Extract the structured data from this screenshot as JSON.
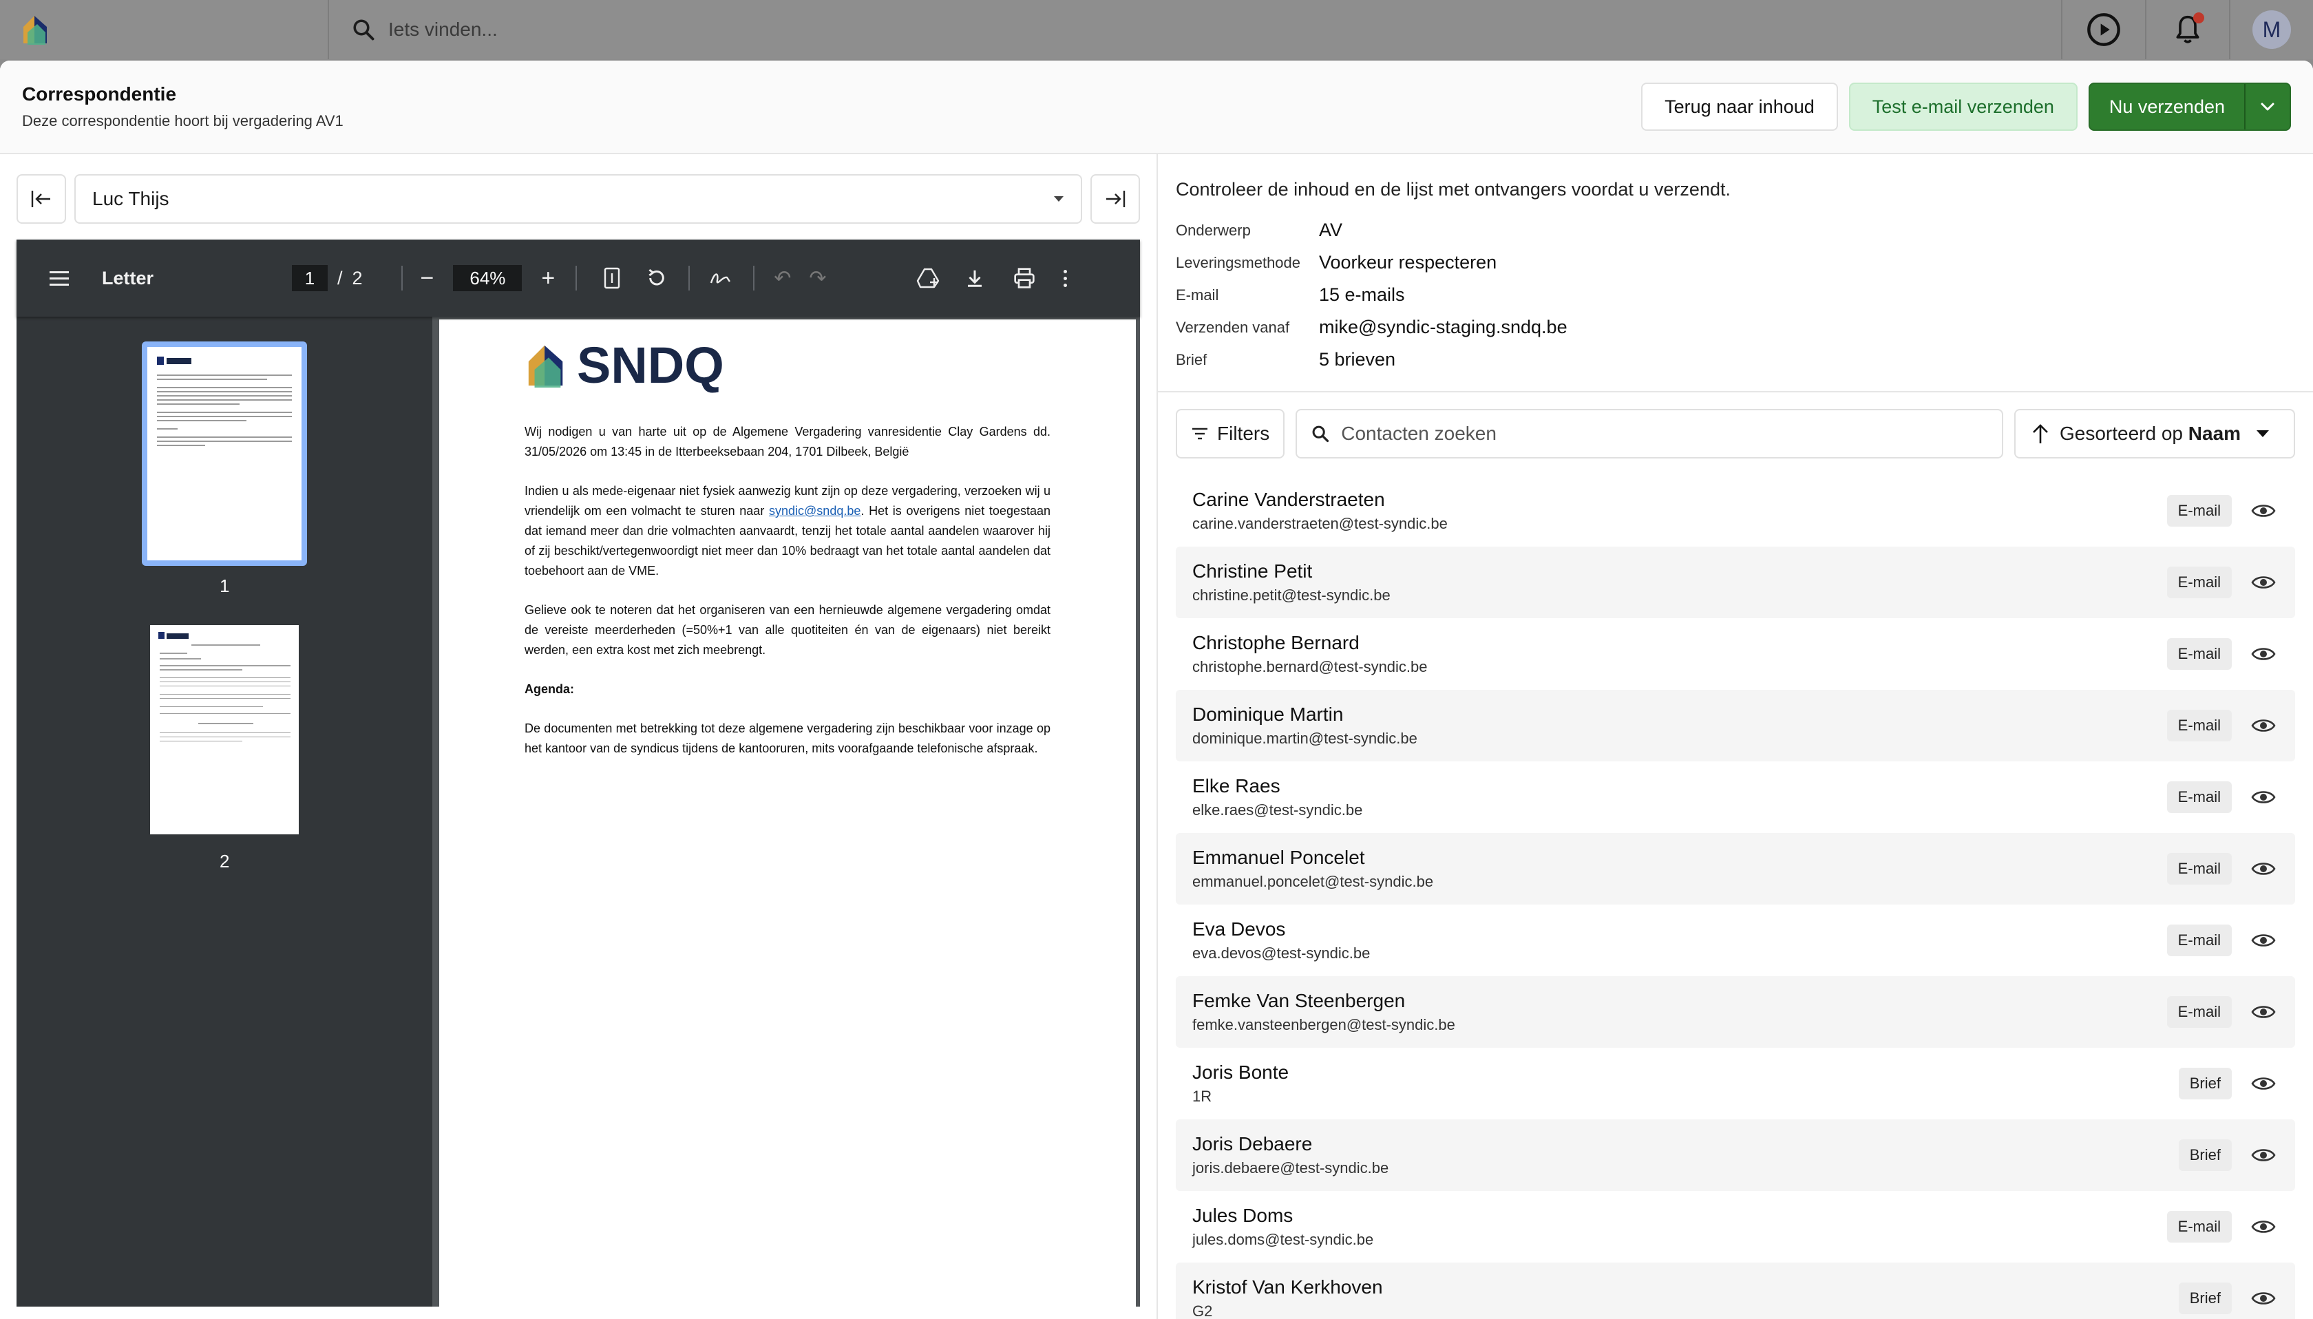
{
  "topbar": {
    "search_placeholder": "Iets vinden...",
    "avatar_initial": "M"
  },
  "header": {
    "title": "Correspondentie",
    "subtitle": "Deze correspondentie hoort bij vergadering AV1",
    "back_label": "Terug naar inhoud",
    "test_label": "Test e-mail verzenden",
    "send_label": "Nu verzenden"
  },
  "recipient_select": {
    "value": "Luc Thijs"
  },
  "pdf": {
    "title": "Letter",
    "page_current": "1",
    "page_sep": "/",
    "page_total": "2",
    "zoom": "64%",
    "thumb1_label": "1",
    "thumb2_label": "2"
  },
  "letter": {
    "brand": "SNDQ",
    "p1": "Wij nodigen u van harte uit op de Algemene Vergadering vanresidentie Clay Gardens dd. 31/05/2026 om 13:45 in de Itterbeeksebaan 204, 1701 Dilbeek, België",
    "p2_a": "Indien u als mede-eigenaar niet fysiek aanwezig kunt zijn op deze vergadering, verzoeken wij u vriendelijk om een volmacht te sturen naar ",
    "p2_link": "syndic@sndq.be",
    "p2_b": ". Het is overigens niet toegestaan dat iemand meer dan drie volmachten aanvaardt, tenzij het totale aantal aandelen waarover hij of zij beschikt/vertegenwoordigt niet meer dan 10% bedraagt van het totale aantal aandelen dat toebehoort aan de VME.",
    "p3": "Gelieve ook te noteren dat het organiseren van een hernieuwde algemene vergadering omdat de vereiste meerderheden (=50%+1 van alle quotiteiten én van de eigenaars) niet bereikt werden, een extra kost met zich meebrengt.",
    "agenda": "Agenda:",
    "p4": "De documenten met betrekking tot deze algemene vergadering zijn beschikbaar voor inzage op het kantoor van de syndicus tijdens de kantooruren, mits voorafgaande telefonische afspraak."
  },
  "summary": {
    "intro": "Controleer de inhoud en de lijst met ontvangers voordat u verzendt.",
    "rows": [
      {
        "key": "Onderwerp",
        "value": "AV"
      },
      {
        "key": "Leveringsmethode",
        "value": "Voorkeur respecteren"
      },
      {
        "key": "E-mail",
        "value": "15 e-mails"
      },
      {
        "key": "Verzenden vanaf",
        "value": "mike@syndic-staging.sndq.be"
      },
      {
        "key": "Brief",
        "value": "5 brieven"
      }
    ]
  },
  "filters": {
    "filter_label": "Filters",
    "search_placeholder": "Contacten zoeken",
    "sort_prefix": "Gesorteerd op ",
    "sort_field": "Naam"
  },
  "contacts": [
    {
      "name": "Carine Vanderstraeten",
      "detail": "carine.vanderstraeten@test-syndic.be",
      "method": "E-mail"
    },
    {
      "name": "Christine Petit",
      "detail": "christine.petit@test-syndic.be",
      "method": "E-mail"
    },
    {
      "name": "Christophe Bernard",
      "detail": "christophe.bernard@test-syndic.be",
      "method": "E-mail"
    },
    {
      "name": "Dominique Martin",
      "detail": "dominique.martin@test-syndic.be",
      "method": "E-mail"
    },
    {
      "name": "Elke Raes",
      "detail": "elke.raes@test-syndic.be",
      "method": "E-mail"
    },
    {
      "name": "Emmanuel Poncelet",
      "detail": "emmanuel.poncelet@test-syndic.be",
      "method": "E-mail"
    },
    {
      "name": "Eva Devos",
      "detail": "eva.devos@test-syndic.be",
      "method": "E-mail"
    },
    {
      "name": "Femke Van Steenbergen",
      "detail": "femke.vansteenbergen@test-syndic.be",
      "method": "E-mail"
    },
    {
      "name": "Joris Bonte",
      "detail": "1R",
      "method": "Brief"
    },
    {
      "name": "Joris Debaere",
      "detail": "joris.debaere@test-syndic.be",
      "method": "Brief"
    },
    {
      "name": "Jules Doms",
      "detail": "jules.doms@test-syndic.be",
      "method": "E-mail"
    },
    {
      "name": "Kristof Van Kerkhoven",
      "detail": "G2",
      "method": "Brief"
    }
  ],
  "colors": {
    "primary_green": "#2e7d2e",
    "test_bg": "#d8f2dc",
    "thumb_highlight": "#8ab4f8"
  }
}
